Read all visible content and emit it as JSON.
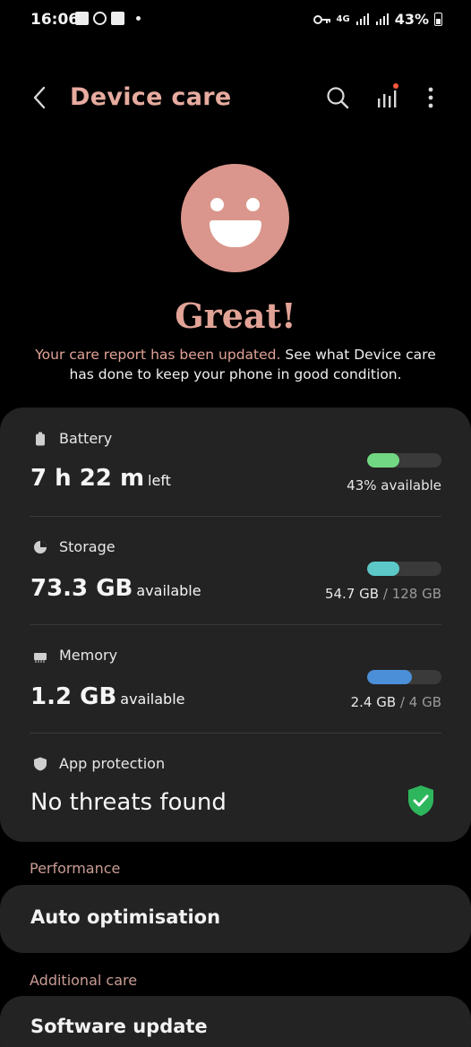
{
  "status_bar": {
    "time": "16:06",
    "network": "4G",
    "battery_percent": "43%",
    "notification_icons": [
      "gallery-icon",
      "whatsapp-icon",
      "facebook-icon",
      "dot-icon"
    ],
    "system_icons": [
      "key-icon",
      "network-4g-icon",
      "signal-icon",
      "signal-icon",
      "battery-icon"
    ]
  },
  "app_bar": {
    "title": "Device care",
    "actions": [
      "search-icon",
      "stats-icon",
      "more-options-icon"
    ]
  },
  "status": {
    "headline": "Great!",
    "description_accent": "Your care report has been updated.",
    "description_rest": " See what Device care has done to keep your phone in good condition."
  },
  "battery": {
    "label": "Battery",
    "value": "7 h 22 m",
    "value_suffix": "left",
    "level": 0.43,
    "right_text": "43% available"
  },
  "storage": {
    "label": "Storage",
    "value": "73.3 GB",
    "value_suffix": "available",
    "level": 0.43,
    "used": "54.7 GB",
    "separator": "/",
    "total": "128 GB"
  },
  "memory": {
    "label": "Memory",
    "value": "1.2 GB",
    "value_suffix": "available",
    "level": 0.6,
    "used": "2.4 GB",
    "separator": "/",
    "total": "4 GB"
  },
  "app_protection": {
    "label": "App protection",
    "value": "No threats found"
  },
  "performance": {
    "header": "Performance",
    "items": [
      {
        "label": "Auto optimisation"
      }
    ]
  },
  "additional_care": {
    "header": "Additional care",
    "items": [
      {
        "label": "Software update"
      }
    ]
  },
  "colors": {
    "accent": "#e2a397",
    "battery_bar": "#72d782",
    "storage_bar": "#5cc8c8",
    "memory_bar": "#4b8fd9",
    "shield": "#2eb65c"
  }
}
